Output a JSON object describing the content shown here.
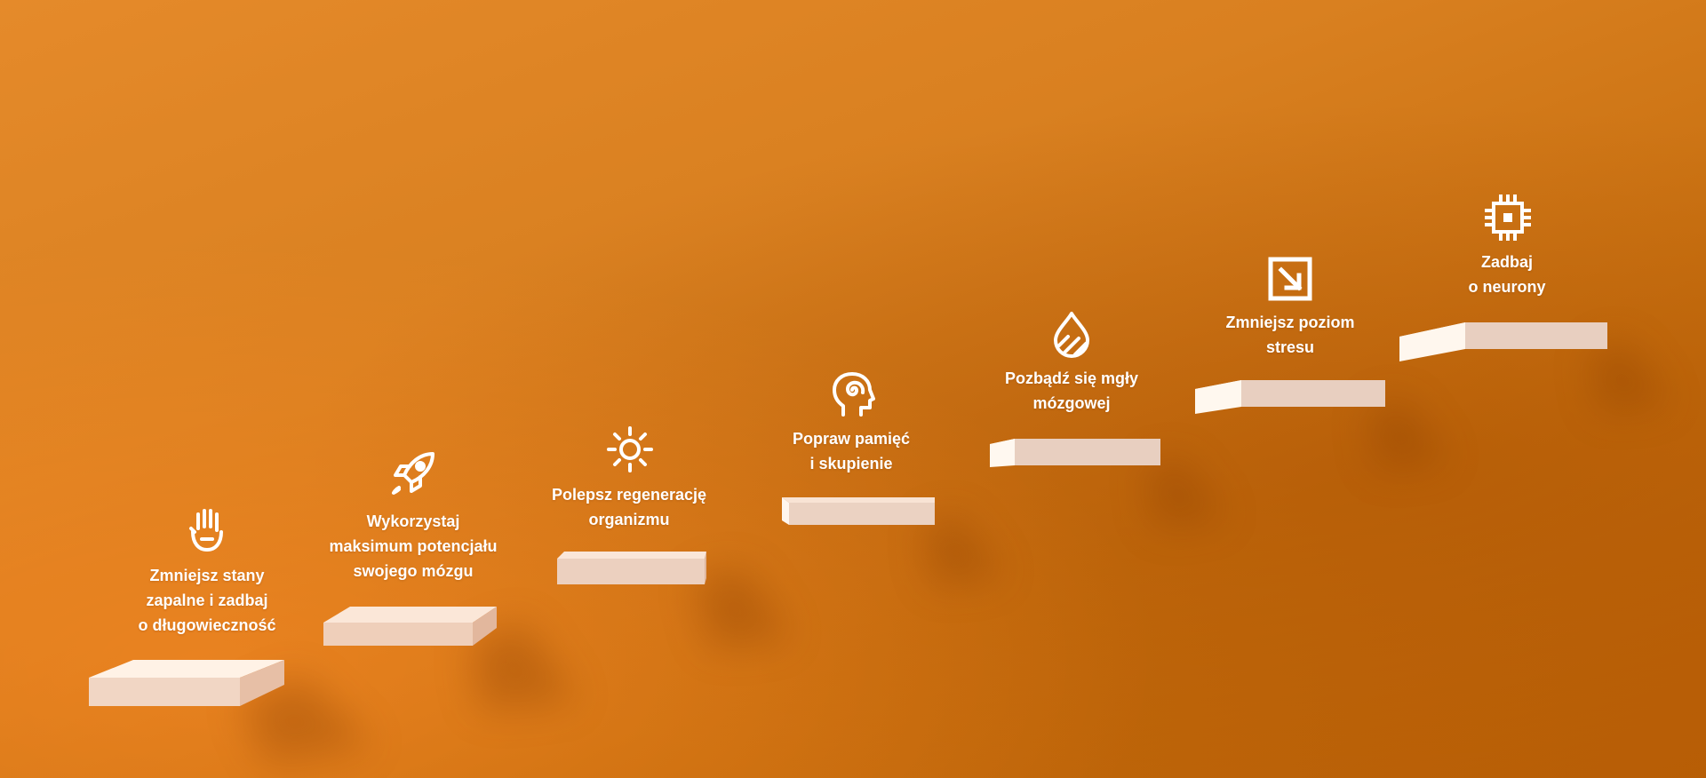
{
  "steps": [
    {
      "icon": "hand-icon",
      "label": "Zmniejsz stany\nzapalne i zadbaj\no długowieczność"
    },
    {
      "icon": "rocket-icon",
      "label": "Wykorzystaj\nmaksimum potencjału\nswojego mózgu"
    },
    {
      "icon": "sun-icon",
      "label": "Polepsz regenerację\norganizmu"
    },
    {
      "icon": "head-spiral-icon",
      "label": "Popraw pamięć\ni skupienie"
    },
    {
      "icon": "drop-icon",
      "label": "Pozbądź się mgły\nmózgowej"
    },
    {
      "icon": "arrow-down-right-box-icon",
      "label": "Zmniejsz poziom\nstresu"
    },
    {
      "icon": "chip-icon",
      "label": "Zadbaj\no neurony"
    }
  ],
  "colors": {
    "background": "#d98020",
    "text": "#ffffff",
    "step_top": "#fbe9dc",
    "step_front": "#efd3c1",
    "step_side": "#f7dccb"
  }
}
